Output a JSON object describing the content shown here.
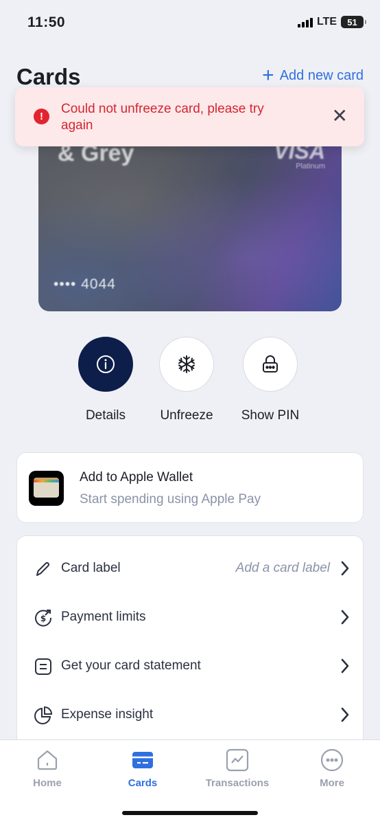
{
  "status_bar": {
    "time": "11:50",
    "network": "LTE",
    "battery": "51"
  },
  "header": {
    "title": "Cards",
    "add_card_label": "Add new card"
  },
  "toast": {
    "message": "Could not unfreeze card, please try again"
  },
  "card": {
    "brand": "& Grey",
    "network": "VISA",
    "tier": "Platinum",
    "masked_number": "•••• 4044"
  },
  "actions": [
    {
      "label": "Details",
      "icon": "info-icon"
    },
    {
      "label": "Unfreeze",
      "icon": "snowflake-icon"
    },
    {
      "label": "Show PIN",
      "icon": "lock-icon"
    }
  ],
  "wallet": {
    "title": "Add to Apple Wallet",
    "subtitle": "Start spending using Apple Pay"
  },
  "settings": [
    {
      "label": "Card label",
      "value": "Add a card label",
      "icon": "pencil-icon"
    },
    {
      "label": "Payment limits",
      "value": "",
      "icon": "dollar-cycle-icon"
    },
    {
      "label": "Get your card statement",
      "value": "",
      "icon": "statement-icon"
    },
    {
      "label": "Expense insight",
      "value": "",
      "icon": "pie-chart-icon"
    }
  ],
  "tabs": [
    {
      "label": "Home",
      "icon": "home-icon",
      "active": false
    },
    {
      "label": "Cards",
      "icon": "card-icon",
      "active": true
    },
    {
      "label": "Transactions",
      "icon": "transactions-icon",
      "active": false
    },
    {
      "label": "More",
      "icon": "more-icon",
      "active": false
    }
  ],
  "colors": {
    "accent": "#2f6fe0",
    "error": "#d4262f",
    "toast_bg": "#fde8ea",
    "dark_button": "#0d1e4a"
  }
}
